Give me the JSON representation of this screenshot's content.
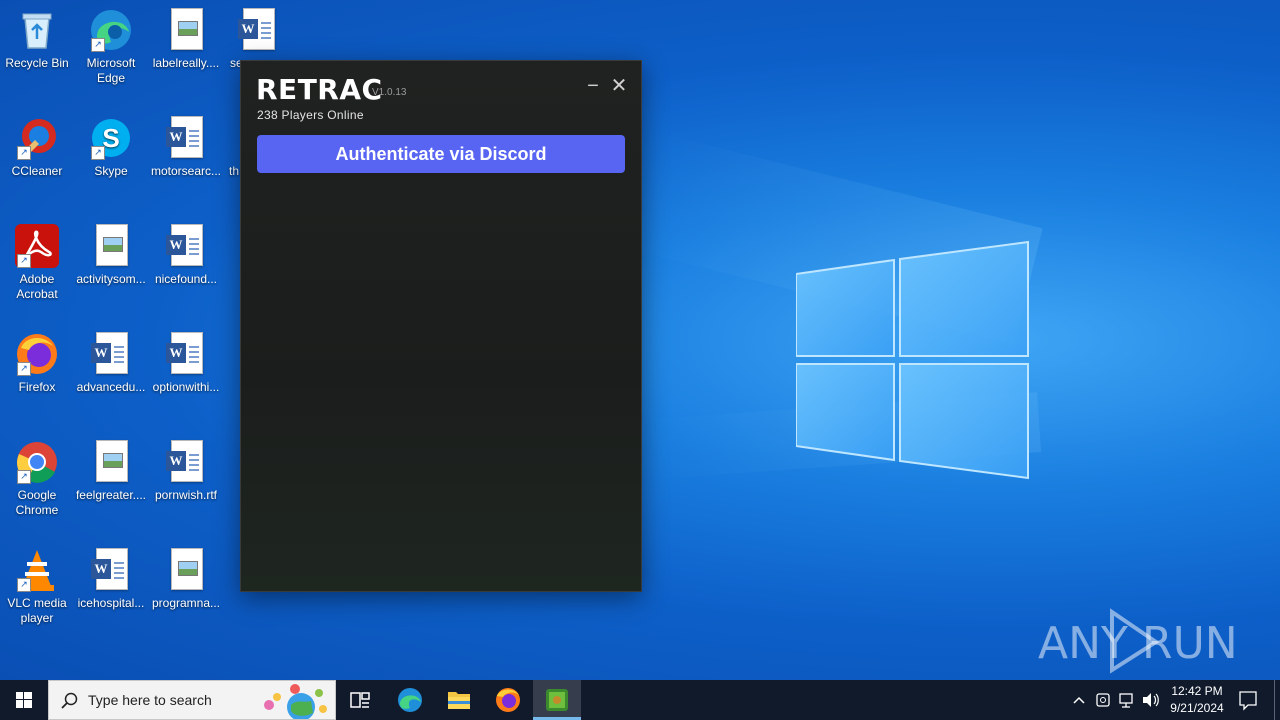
{
  "desktop": {
    "icons": [
      {
        "label": "Recycle Bin"
      },
      {
        "label": "Microsoft Edge"
      },
      {
        "label": "labelreally...."
      },
      {
        "label": "se"
      },
      {
        "label": "CCleaner"
      },
      {
        "label": "Skype"
      },
      {
        "label": "motorsearc..."
      },
      {
        "label": "th"
      },
      {
        "label": "Adobe Acrobat"
      },
      {
        "label": "activitysom..."
      },
      {
        "label": "nicefound..."
      },
      {
        "label": "Firefox"
      },
      {
        "label": "advancedu..."
      },
      {
        "label": "optionwithi..."
      },
      {
        "label": "Google Chrome"
      },
      {
        "label": "feelgreater...."
      },
      {
        "label": "pornwish.rtf"
      },
      {
        "label": "VLC media player"
      },
      {
        "label": "icehospital..."
      },
      {
        "label": "programna..."
      }
    ]
  },
  "app": {
    "title": "RETRAC",
    "version": "V1.0.13",
    "players_online": "238 Players Online",
    "minimize_label": "−",
    "close_label": "✕",
    "auth_button": "Authenticate via Discord",
    "accent": "#5865f2"
  },
  "watermark": {
    "text": "ANY RUN"
  },
  "taskbar": {
    "search_placeholder": "Type here to search",
    "time": "12:42 PM",
    "date": "9/21/2024"
  }
}
